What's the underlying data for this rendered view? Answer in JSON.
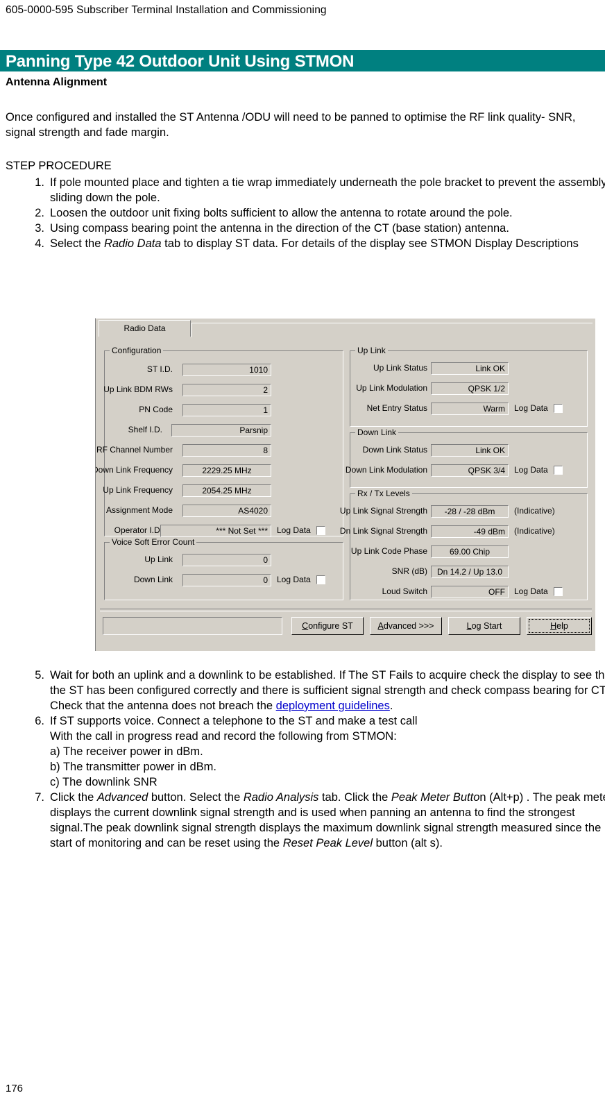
{
  "document": {
    "running_header": "605-0000-595 Subscriber Terminal Installation and Commissioning",
    "section_title": "Panning Type 42 Outdoor Unit Using STMON",
    "sub_heading": "Antenna Alignment",
    "intro_paragraph": "Once configured and installed the ST Antenna /ODU will need to be panned to optimise the RF link quality- SNR, signal strength and fade margin.",
    "steps_heading": "STEP PROCEDURE",
    "page_number": "176",
    "accent_color": "#008080",
    "link_color": "#0000cc"
  },
  "steps_top": [
    {
      "num": "1.",
      "text": "If pole mounted place and tighten a tie wrap immediately underneath the pole bracket to prevent the assembly sliding down the pole."
    },
    {
      "num": "2.",
      "text": "Loosen the outdoor unit fixing bolts sufficient to allow the antenna to rotate around the pole."
    },
    {
      "num": "3.",
      "text": "Using compass bearing point the antenna in the direction of the CT (base station) antenna."
    },
    {
      "num": "4.",
      "prefix": "Select the ",
      "italic": "Radio Data",
      "suffix": " tab to display ST data. For details of the display see STMON Display Descriptions"
    }
  ],
  "steps_bottom": {
    "step5": {
      "num": "5.",
      "prefix": "Wait for both an uplink and a downlink to be established. If The ST Fails to acquire check the display to see that the ST has been configured correctly and there is sufficient signal strength and check compass bearing for CT. Check that the antenna does not breach the ",
      "link": "deployment guidelines",
      "suffix": "."
    },
    "step6": {
      "num": "6.",
      "line1": "If ST supports voice. Connect a telephone to the ST and make a test call",
      "line2": "With the call in progress read and record the following from STMON:",
      "items": [
        "a) The receiver power in dBm.",
        "b) The transmitter power in dBm.",
        "c) The downlink SNR"
      ]
    },
    "step7": {
      "num": "7.",
      "p1": "Click the ",
      "i1": "Advanced",
      "p2": " button. Select the ",
      "i2": "Radio Analysis",
      "p3": " tab. Click the ",
      "i3": "Peak Meter Butto",
      "p4": "n (Alt+p) . The peak meter displays the current downlink signal strength and is used when panning an antenna to find the strongest signal.The peak downlink signal strength displays the  maximum downlink signal strength measured since the start of monitoring and  can be reset using the ",
      "i4": "Reset Peak Level",
      "p5": " button (alt s)."
    }
  },
  "stmon_dialog": {
    "tab": {
      "selected": "Radio Data"
    },
    "configuration": {
      "group_title": "Configuration",
      "fields": [
        {
          "label": "ST I.D.",
          "value": "1010"
        },
        {
          "label": "Up Link BDM RWs",
          "value": "2"
        },
        {
          "label": "PN Code",
          "value": "1"
        },
        {
          "label": "Shelf  I.D.",
          "value": "Parsnip"
        },
        {
          "label": "RF Channel Number",
          "value": "8"
        },
        {
          "label": "Down Link Frequency",
          "value": "2229.25 MHz"
        },
        {
          "label": "Up Link Frequency",
          "value": "2054.25 MHz"
        },
        {
          "label": "Assignment Mode",
          "value": "AS4020"
        },
        {
          "label": "Operator I.D.",
          "value": "*** Not Set ***",
          "log_data": "Log Data",
          "checked": false
        }
      ]
    },
    "voice_soft_error_count": {
      "group_title": "Voice Soft Error Count",
      "fields": [
        {
          "label": "Up Link",
          "value": "0"
        },
        {
          "label": "Down Link",
          "value": "0",
          "log_data": "Log Data",
          "checked": false
        }
      ]
    },
    "up_link": {
      "group_title": "Up Link",
      "fields": [
        {
          "label": "Up Link Status",
          "value": "Link OK"
        },
        {
          "label": "Up Link Modulation",
          "value": "QPSK 1/2"
        },
        {
          "label": "Net Entry Status",
          "value": "Warm",
          "log_data": "Log Data",
          "checked": false
        }
      ]
    },
    "down_link": {
      "group_title": "Down Link",
      "fields": [
        {
          "label": "Down Link Status",
          "value": "Link OK"
        },
        {
          "label": "Down Link Modulation",
          "value": "QPSK 3/4",
          "log_data": "Log Data",
          "checked": false
        }
      ]
    },
    "rx_tx_levels": {
      "group_title": "Rx / Tx Levels",
      "fields": [
        {
          "label": "Up Link Signal Strength",
          "value": "-28 / -28 dBm",
          "suffix": "(Indicative)"
        },
        {
          "label": "Dn Link Signal Strength",
          "value": "-49 dBm",
          "suffix": "(Indicative)"
        },
        {
          "label": "Up Link Code Phase",
          "value": "69.00 Chip"
        },
        {
          "label": "SNR (dB)",
          "value": "Dn 14.2 / Up 13.0"
        },
        {
          "label": "Loud Switch",
          "value": "OFF",
          "log_data": "Log Data",
          "checked": false
        }
      ]
    },
    "status_field": {
      "value": ""
    },
    "buttons": [
      {
        "name": "configure-st",
        "accel": "C",
        "before": "",
        "after": "onfigure ST"
      },
      {
        "name": "advanced",
        "accel": "A",
        "before": "",
        "after": "dvanced >>>"
      },
      {
        "name": "log-start",
        "accel": "L",
        "before": "",
        "after": "og Start"
      },
      {
        "name": "help",
        "accel": "H",
        "before": "",
        "after": "elp"
      }
    ]
  }
}
